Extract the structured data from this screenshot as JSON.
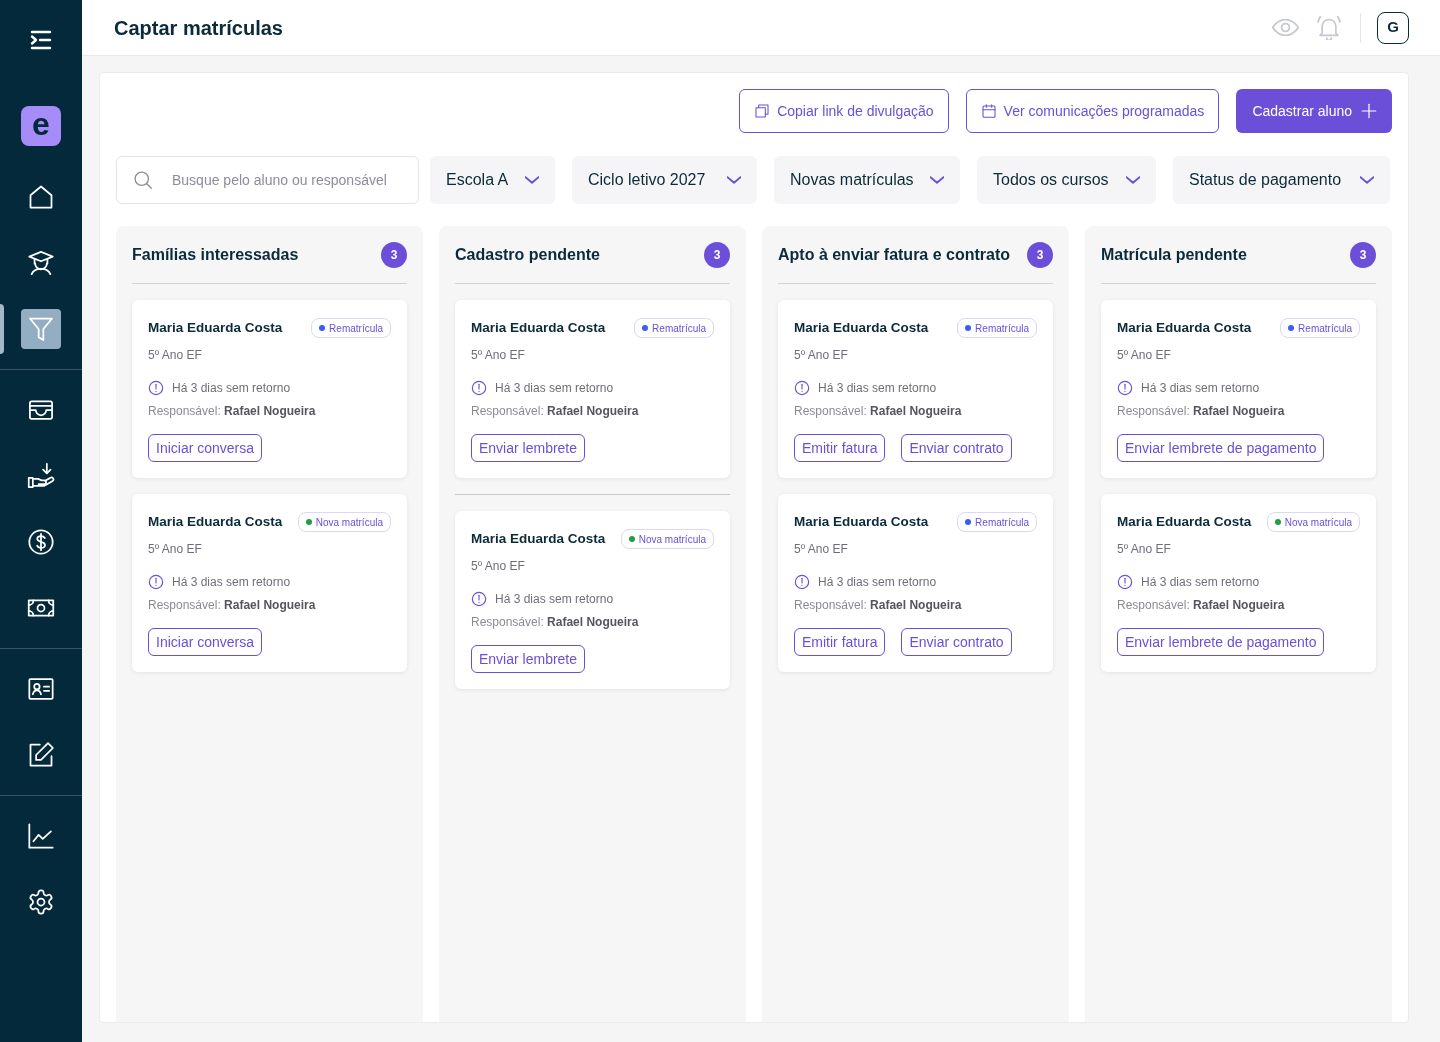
{
  "sidebar": {
    "logo": "e",
    "groups": [
      {
        "items": [
          {
            "selected": false
          },
          {
            "selected": false
          },
          {
            "selected": true
          }
        ]
      },
      {
        "items": [
          {
            "selected": false
          },
          {
            "selected": false
          },
          {
            "selected": false
          },
          {
            "selected": false
          }
        ]
      },
      {
        "items": [
          {
            "selected": false
          },
          {
            "selected": false
          }
        ]
      },
      {
        "items": [
          {
            "selected": false
          },
          {
            "selected": false
          }
        ]
      }
    ]
  },
  "header": {
    "title": "Captar matrículas",
    "avatar": "G"
  },
  "actions": [
    {
      "label": "Copiar link de divulgação",
      "kind": "outline"
    },
    {
      "label": "Ver comunicações programadas",
      "kind": "outline"
    },
    {
      "label": "Cadastrar aluno",
      "kind": "primary"
    }
  ],
  "search": {
    "placeholder": "Busque pelo aluno ou responsável"
  },
  "filters": [
    "Escola A",
    "Ciclo letivo 2027",
    "Novas matrículas",
    "Todos os cursos",
    "Status de pagamento"
  ],
  "columns": [
    {
      "title": "Famílias interessadas",
      "count": "3",
      "cards": [
        {
          "name": "Maria Eduarda Costa",
          "tag": {
            "label": "Rematrícula",
            "color": "#3b5bf6"
          },
          "grade": "5º Ano EF",
          "alert": "Há 3 dias sem retorno",
          "guardian": "Responsável: **Rafael Nogueira**",
          "buttons": [
            "Iniciar conversa"
          ],
          "divider_above": false
        },
        {
          "name": "Maria Eduarda Costa",
          "tag": {
            "label": "Nova matrícula",
            "color": "#1e9e45"
          },
          "grade": "5º Ano EF",
          "alert": "Há 3 dias sem retorno",
          "guardian": "Responsável: **Rafael Nogueira**",
          "buttons": [
            "Iniciar conversa"
          ],
          "divider_above": false
        }
      ]
    },
    {
      "title": "Cadastro pendente",
      "count": "3",
      "cards": [
        {
          "name": "Maria Eduarda Costa",
          "tag": {
            "label": "Rematrícula",
            "color": "#3b5bf6"
          },
          "grade": "5º Ano EF",
          "alert": "Há 3 dias sem retorno",
          "guardian": "Responsável: **Rafael Nogueira**",
          "buttons": [
            "Enviar lembrete"
          ],
          "divider_above": false
        },
        {
          "name": "Maria Eduarda Costa",
          "tag": {
            "label": "Nova matrícula",
            "color": "#1e9e45"
          },
          "grade": "5º Ano EF",
          "alert": "Há 3 dias sem retorno",
          "guardian": "Responsável: **Rafael Nogueira**",
          "buttons": [
            "Enviar lembrete"
          ],
          "divider_above": true
        }
      ]
    },
    {
      "title": "Apto à enviar fatura e contrato",
      "count": "3",
      "cards": [
        {
          "name": "Maria Eduarda Costa",
          "tag": {
            "label": "Rematrícula",
            "color": "#3b5bf6"
          },
          "grade": "5º Ano EF",
          "alert": "Há 3 dias sem retorno",
          "guardian": "Responsável: **Rafael Nogueira**",
          "buttons": [
            "Emitir fatura",
            "Enviar contrato"
          ],
          "divider_above": false
        },
        {
          "name": "Maria Eduarda Costa",
          "tag": {
            "label": "Rematrícula",
            "color": "#3b5bf6"
          },
          "grade": "5º Ano EF",
          "alert": "Há 3 dias sem retorno",
          "guardian": "Responsável: **Rafael Nogueira**",
          "buttons": [
            "Emitir fatura",
            "Enviar contrato"
          ],
          "divider_above": false
        }
      ]
    },
    {
      "title": "Matrícula pendente",
      "count": "3",
      "cards": [
        {
          "name": "Maria Eduarda Costa",
          "tag": {
            "label": "Rematrícula",
            "color": "#3b5bf6"
          },
          "grade": "5º Ano EF",
          "alert": "Há 3 dias sem retorno",
          "guardian": "Responsável: **Rafael Nogueira**",
          "buttons": [
            "Enviar lembrete de pagamento"
          ],
          "divider_above": false
        },
        {
          "name": "Maria Eduarda Costa",
          "tag": {
            "label": "Nova matrícula",
            "color": "#1e9e45"
          },
          "grade": "5º Ano EF",
          "alert": "Há 3 dias sem retorno",
          "guardian": "Responsável: **Rafael Nogueira**",
          "buttons": [
            "Enviar lembrete de pagamento"
          ],
          "divider_above": false
        }
      ]
    }
  ]
}
